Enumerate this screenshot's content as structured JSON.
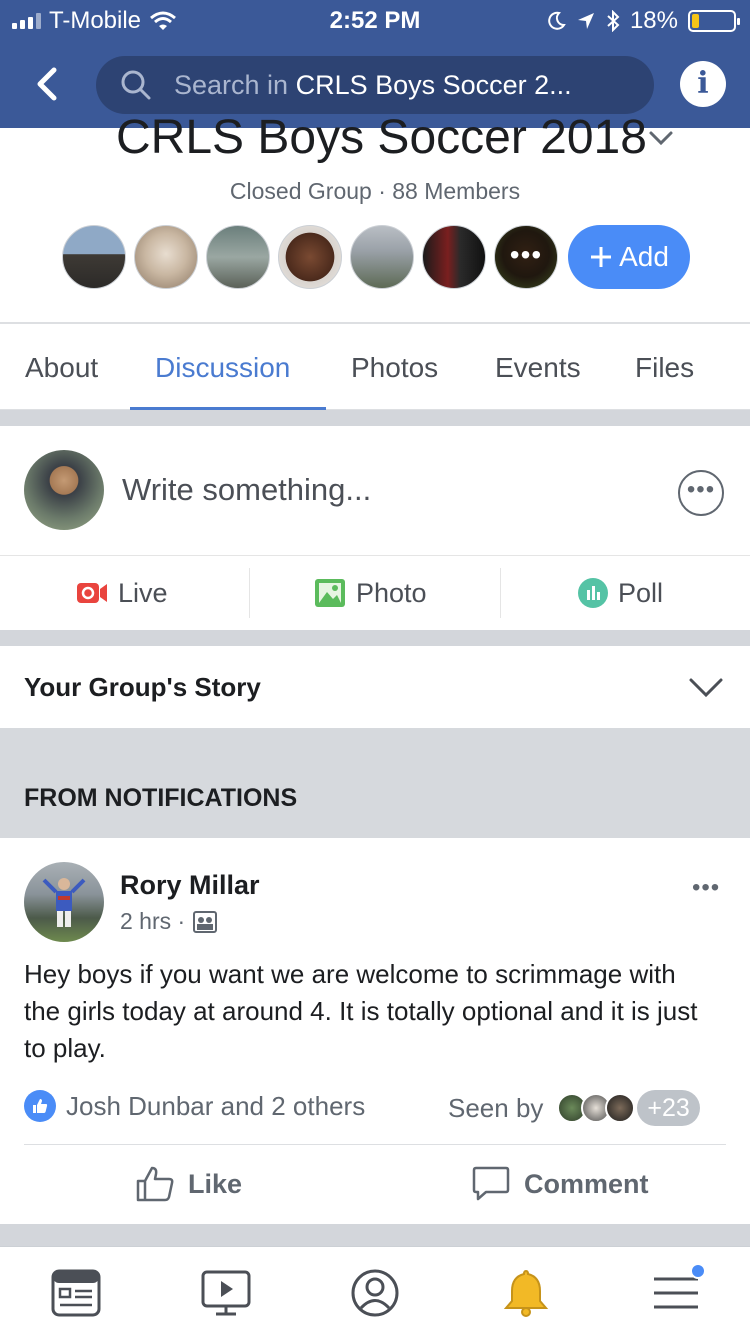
{
  "status_bar": {
    "carrier": "T-Mobile",
    "time": "2:52 PM",
    "battery_percent": "18%",
    "battery_level": 0.18
  },
  "nav": {
    "search_prefix": "Search in ",
    "search_group": "CRLS Boys Soccer 2...",
    "info_glyph": "i"
  },
  "group": {
    "title": "CRLS Boys Soccer 2018",
    "meta": "Closed Group · 88 Members",
    "add_label": "Add",
    "more_members_glyph": "•••"
  },
  "tabs": [
    {
      "label": "About"
    },
    {
      "label": "Discussion",
      "active": true
    },
    {
      "label": "Photos"
    },
    {
      "label": "Events"
    },
    {
      "label": "Files"
    }
  ],
  "composer": {
    "placeholder": "Write something...",
    "more_glyph": "•••",
    "actions": {
      "live": "Live",
      "photo": "Photo",
      "poll": "Poll"
    }
  },
  "story": {
    "title": "Your Group's Story"
  },
  "notifications": {
    "header": "FROM NOTIFICATIONS"
  },
  "post": {
    "author": "Rory Millar",
    "time": "2 hrs ·",
    "more_glyph": "•••",
    "body": "Hey boys if you want we are welcome to scrimmage with the girls today at around 4. It is totally optional and it is just to play.",
    "reactions_text": "Josh Dunbar and 2 others",
    "seen_label": "Seen by",
    "seen_count": "+23",
    "like_label": "Like",
    "comment_label": "Comment"
  },
  "colors": {
    "brand": "#3b5998",
    "accent": "#4a8cf7",
    "live_red": "#e9443e",
    "photo_green": "#5bbb5c",
    "poll_teal": "#55c3a5",
    "bell_yellow": "#f2b926"
  },
  "icons": {
    "tabbar": [
      "news-feed-icon",
      "watch-icon",
      "profile-icon",
      "notifications-bell-icon",
      "menu-icon"
    ]
  }
}
